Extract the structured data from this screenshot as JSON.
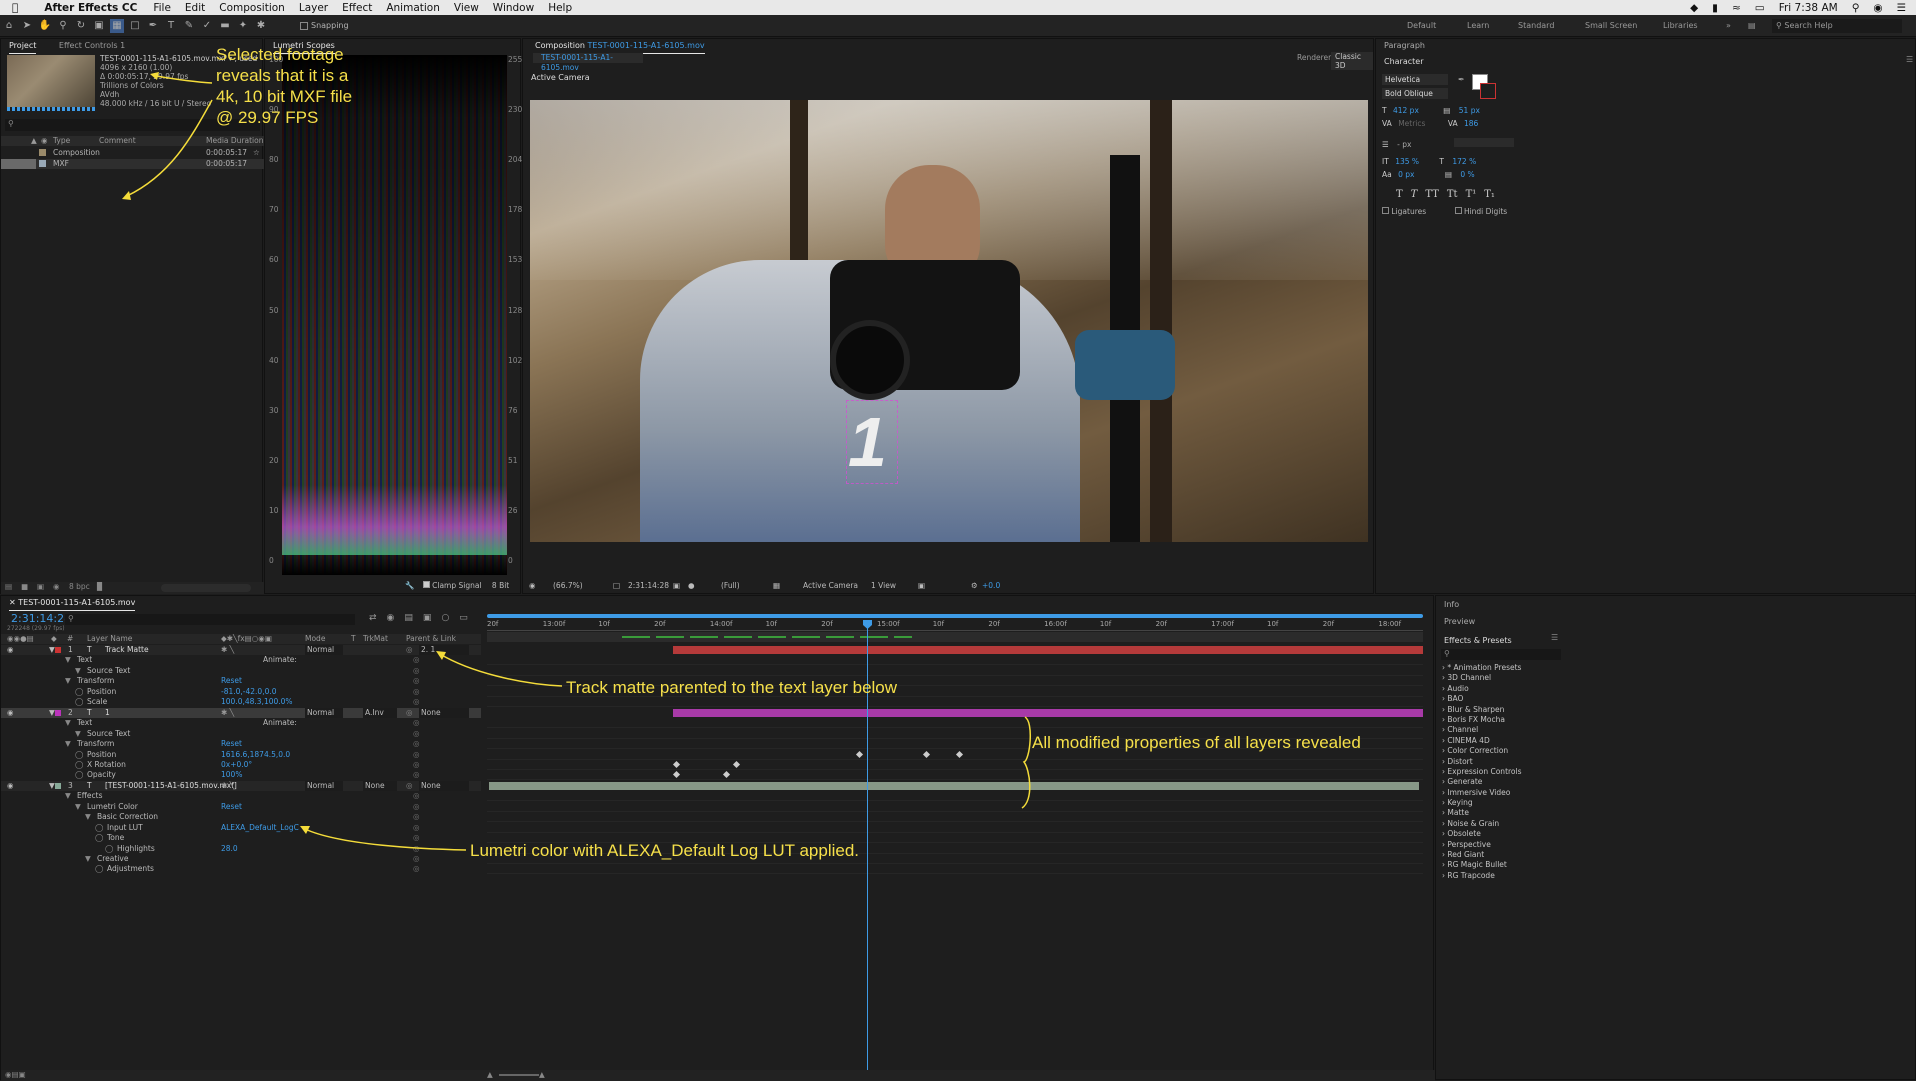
{
  "menubar": {
    "app_name": "After Effects CC",
    "items": [
      "File",
      "Edit",
      "Composition",
      "Layer",
      "Effect",
      "Animation",
      "View",
      "Window",
      "Help"
    ],
    "clock": "Fri 7:38 AM"
  },
  "toolbar": {
    "snapping_label": "Snapping",
    "workspaces": [
      "Default",
      "Learn",
      "Standard",
      "Small Screen",
      "Libraries"
    ],
    "search_placeholder": "Search Help"
  },
  "project_panel": {
    "tab_project": "Project",
    "tab_effect_controls": "Effect Controls 1",
    "footage_name": "TEST-0001-115-A1-6105.mov.mxf ▾ , used",
    "footage_lines": [
      "4096 x 2160 (1.00)",
      "Δ 0:00:05:17, 29.97 fps",
      "Trillions of Colors",
      "AVdh",
      "48.000 kHz / 16 bit U / Stereo"
    ],
    "columns": {
      "type": "Type",
      "comment": "Comment",
      "duration": "Media Duration"
    },
    "items": [
      {
        "name": "Composition",
        "duration": "0:00:05:17"
      },
      {
        "name": "MXF",
        "duration": "0:00:05:17"
      }
    ],
    "bpc": "8 bpc"
  },
  "scopes_panel": {
    "tab": "Lumetri Scopes",
    "left_ticks": [
      "100",
      "90",
      "80",
      "70",
      "60",
      "50",
      "40",
      "30",
      "20",
      "10",
      "0"
    ],
    "right_ticks": [
      "255",
      "230",
      "204",
      "178",
      "153",
      "128",
      "102",
      "76",
      "51",
      "26",
      "0"
    ],
    "clamp_label": "Clamp Signal",
    "bit_label": "8 Bit"
  },
  "comp_panel": {
    "tab_prefix": "Composition",
    "tab_name": "TEST-0001-115-A1-6105.mov",
    "sub_tab": "TEST-0001-115-A1-6105.mov",
    "renderer_label": "Renderer:",
    "renderer_value": "Classic 3D",
    "active_camera": "Active Camera",
    "footer": {
      "zoom": "(66.7%)",
      "timecode": "2:31:14:28",
      "res": "(Full)",
      "camera": "Active Camera",
      "view": "1 View",
      "exposure": "+0.0"
    }
  },
  "right_panel": {
    "paragraph": "Paragraph",
    "character": "Character",
    "font_family": "Helvetica",
    "font_style": "Bold Oblique",
    "font_size": "412 px",
    "leading": "51 px",
    "kerning": "Metrics",
    "tracking": "186",
    "stroke": "- px",
    "vscale": "135 %",
    "hscale": "172 %",
    "baseline": "0 px",
    "tsume": "0 %",
    "style_buttons": [
      "T",
      "T",
      "TT",
      "Tt",
      "T¹",
      "T₁"
    ],
    "ligatures": "Ligatures",
    "hindi": "Hindi Digits"
  },
  "timeline": {
    "tab": "TEST-0001-115-A1-6105.mov",
    "timecode": "2:31:14:28",
    "frame": "272248 (29.97 fps)",
    "col_layer": "Layer Name",
    "col_mode": "Mode",
    "col_t": "T",
    "col_trkmat": "TrkMat",
    "col_parent": "Parent & Link",
    "ruler": [
      "20f",
      "13:00f",
      "10f",
      "20f",
      "14:00f",
      "10f",
      "20f",
      "15:00f",
      "10f",
      "20f",
      "16:00f",
      "10f",
      "20f",
      "17:00f",
      "10f",
      "20f",
      "18:00f"
    ],
    "rows": [
      {
        "indent": 0,
        "num": "1",
        "label": "Track Matte",
        "mode": "Normal",
        "parent": "2. 1",
        "kind": "layer",
        "color": "#c33"
      },
      {
        "indent": 1,
        "label": "Text",
        "right": "Animate:"
      },
      {
        "indent": 2,
        "label": "Source Text"
      },
      {
        "indent": 1,
        "label": "Transform",
        "right": "Reset"
      },
      {
        "indent": 2,
        "label": "Position",
        "value": "-81.0,-42.0,0.0"
      },
      {
        "indent": 2,
        "label": "Scale",
        "value": "100.0,48.3,100.0%"
      },
      {
        "indent": 0,
        "num": "2",
        "label": "1",
        "mode": "Normal",
        "trkmat": "A.Inv",
        "parent": "None",
        "kind": "layer",
        "color": "#b3b"
      },
      {
        "indent": 1,
        "label": "Text",
        "right": "Animate:"
      },
      {
        "indent": 2,
        "label": "Source Text"
      },
      {
        "indent": 1,
        "label": "Transform",
        "right": "Reset"
      },
      {
        "indent": 2,
        "label": "Position",
        "value": "1616.6,1874.5,0.0"
      },
      {
        "indent": 2,
        "label": "X Rotation",
        "value": "0x+0.0°"
      },
      {
        "indent": 2,
        "label": "Opacity",
        "value": "100%"
      },
      {
        "indent": 0,
        "num": "3",
        "label": "[TEST-0001-115-A1-6105.mov.mxf]",
        "mode": "Normal",
        "trkmat": "None",
        "parent": "None",
        "kind": "layer",
        "color": "#8a9"
      },
      {
        "indent": 1,
        "label": "Effects"
      },
      {
        "indent": 2,
        "label": "Lumetri Color",
        "right": "Reset"
      },
      {
        "indent": 3,
        "label": "Basic Correction"
      },
      {
        "indent": 4,
        "label": "Input LUT",
        "value": "ALEXA_Default_LogC"
      },
      {
        "indent": 4,
        "label": "Tone"
      },
      {
        "indent": 5,
        "label": "Highlights",
        "value": "28.0"
      },
      {
        "indent": 3,
        "label": "Creative"
      },
      {
        "indent": 4,
        "label": "Adjustments"
      }
    ]
  },
  "info_panel": {
    "info": "Info",
    "preview": "Preview",
    "effects_presets": "Effects & Presets",
    "items": [
      "* Animation Presets",
      "3D Channel",
      "Audio",
      "BAO",
      "Blur & Sharpen",
      "Boris FX Mocha",
      "Channel",
      "CINEMA 4D",
      "Color Correction",
      "Distort",
      "Expression Controls",
      "Generate",
      "Immersive Video",
      "Keying",
      "Matte",
      "Noise & Grain",
      "Obsolete",
      "Perspective",
      "Red Giant",
      "RG Magic Bullet",
      "RG Trapcode"
    ]
  },
  "annotations": {
    "footage": [
      "Selected footage",
      "reveals that it is a",
      "4k, 10 bit MXF file",
      "@ 29.97 FPS"
    ],
    "track_matte": "Track matte parented to the text layer below",
    "modified": "All modified properties of all layers revealed",
    "lumetri": "Lumetri color with ALEXA_Default Log LUT applied."
  },
  "colors": {
    "accent": "#3e9be6",
    "annotation": "#f6e04a",
    "timeline_red": "#b53a3a",
    "timeline_magenta": "#a83aa8",
    "timeline_sage": "#879887"
  }
}
